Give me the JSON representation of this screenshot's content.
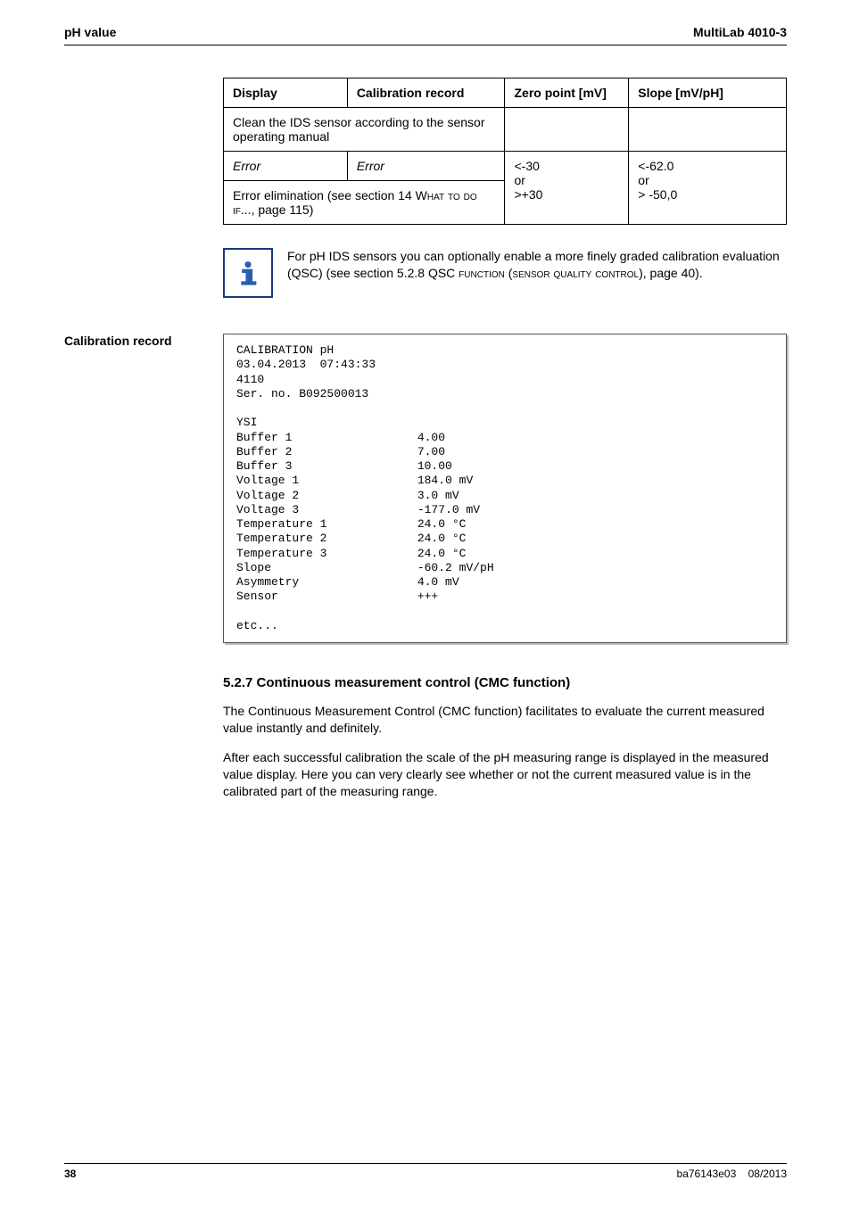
{
  "header": {
    "left": "pH value",
    "right": "MultiLab 4010-3"
  },
  "table": {
    "cols": {
      "display": "Display",
      "record": "Calibration record",
      "zero": "Zero point [mV]",
      "slope": "Slope [mV/pH]"
    },
    "row_clean": "Clean the IDS sensor according to the sensor operating manual",
    "row_error": {
      "c1": "Error",
      "c2": "Error",
      "zero": "<-30\nor\n>+30",
      "slope": "<-62.0\nor\n> -50,0"
    },
    "row_elim_a": "Error elimination (see section 14 ",
    "row_elim_b": "What to do if...",
    "row_elim_c": ", page 115)"
  },
  "info": {
    "a": "For pH IDS sensors you can optionally enable a more finely graded calibration evaluation (QSC) (see section 5.2.8 QSC ",
    "b": "function (sensor quality control)",
    "c": ", page 40)."
  },
  "recordLabel": "Calibration record",
  "record": {
    "l01": "CALIBRATION pH",
    "l02": "03.04.2013  07:43:33",
    "l03": "4110",
    "l04": "Ser. no. B092500013",
    "l05": "",
    "l06": "YSI",
    "rows": [
      [
        "Buffer 1",
        "4.00"
      ],
      [
        "Buffer 2",
        "7.00"
      ],
      [
        "Buffer 3",
        "10.00"
      ],
      [
        "Voltage 1",
        "184.0 mV"
      ],
      [
        "Voltage 2",
        "3.0 mV"
      ],
      [
        "Voltage 3",
        "-177.0 mV"
      ],
      [
        "Temperature 1",
        "24.0 °C"
      ],
      [
        "Temperature 2",
        "24.0 °C"
      ],
      [
        "Temperature 3",
        "24.0 °C"
      ],
      [
        "Slope",
        "-60.2 mV/pH"
      ],
      [
        "Asymmetry",
        "4.0 mV"
      ],
      [
        "Sensor",
        "+++"
      ]
    ],
    "last": "etc..."
  },
  "section": {
    "title": "5.2.7   Continuous measurement control (CMC function)",
    "p1": "The Continuous Measurement Control (CMC function) facilitates to evaluate the current measured value instantly and definitely.",
    "p2": "After each successful calibration the scale of the pH measuring range is displayed in the measured value display. Here you can very clearly see whether or not the current measured value is in the calibrated part of the measuring range."
  },
  "footer": {
    "page": "38",
    "doc": "ba76143e03",
    "date": "08/2013"
  }
}
